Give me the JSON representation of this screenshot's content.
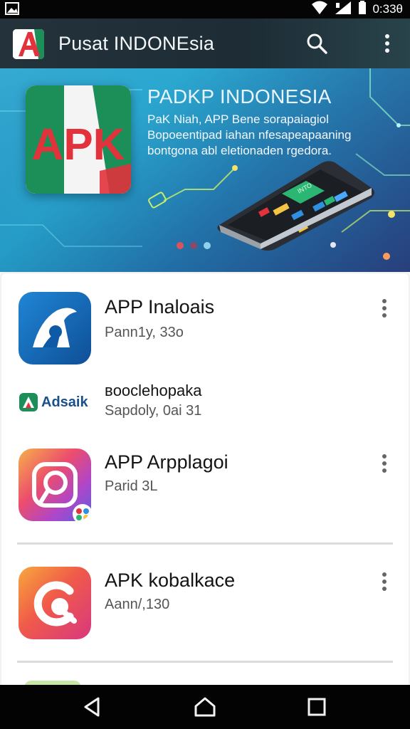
{
  "status_bar": {
    "time": "0:33θ",
    "icons": [
      "image-icon",
      "wifi-icon",
      "signal-icon",
      "battery-icon"
    ]
  },
  "app_bar": {
    "title": "Pusat INDONEsia",
    "logo_text": "A",
    "search_icon": "search-icon",
    "more_icon": "more-vert-icon"
  },
  "banner": {
    "logo_text": "APK",
    "title": "PADKP INDONESIA",
    "lines": [
      "PaK Niah, APP Bene sorapaiagiol",
      "Bopoeentipad iahan nfesapeapaaning",
      "bontgona abl eletionaden rgedora."
    ],
    "page_indicator": 3,
    "active_page": 1,
    "phone_screen_text": "INTO"
  },
  "apps": [
    {
      "name": "APP Inaloais",
      "meta": "Pann1y, 33o",
      "icon": "app-a-icon",
      "has_menu": true
    },
    {
      "name": "вooclehopaka",
      "meta": "Sapdoly, 0ai 31",
      "icon": "adsaik-logo",
      "brand_text": "Adsaik",
      "has_menu": false
    },
    {
      "name": "APP Arpplagoi",
      "meta": "Parid 3L",
      "icon": "instagram-like-icon",
      "has_menu": true
    },
    {
      "name": "APK kobalkace",
      "meta": "Aann/,130",
      "icon": "chat-g-icon",
      "has_menu": true
    }
  ],
  "colors": {
    "app_bar": "#22313a",
    "banner_accent": "#1aa2cd",
    "brand_red": "#e2323c",
    "brand_green": "#1c8e57"
  },
  "nav_bar": {
    "buttons": [
      "back-icon",
      "home-icon",
      "recents-icon"
    ]
  }
}
